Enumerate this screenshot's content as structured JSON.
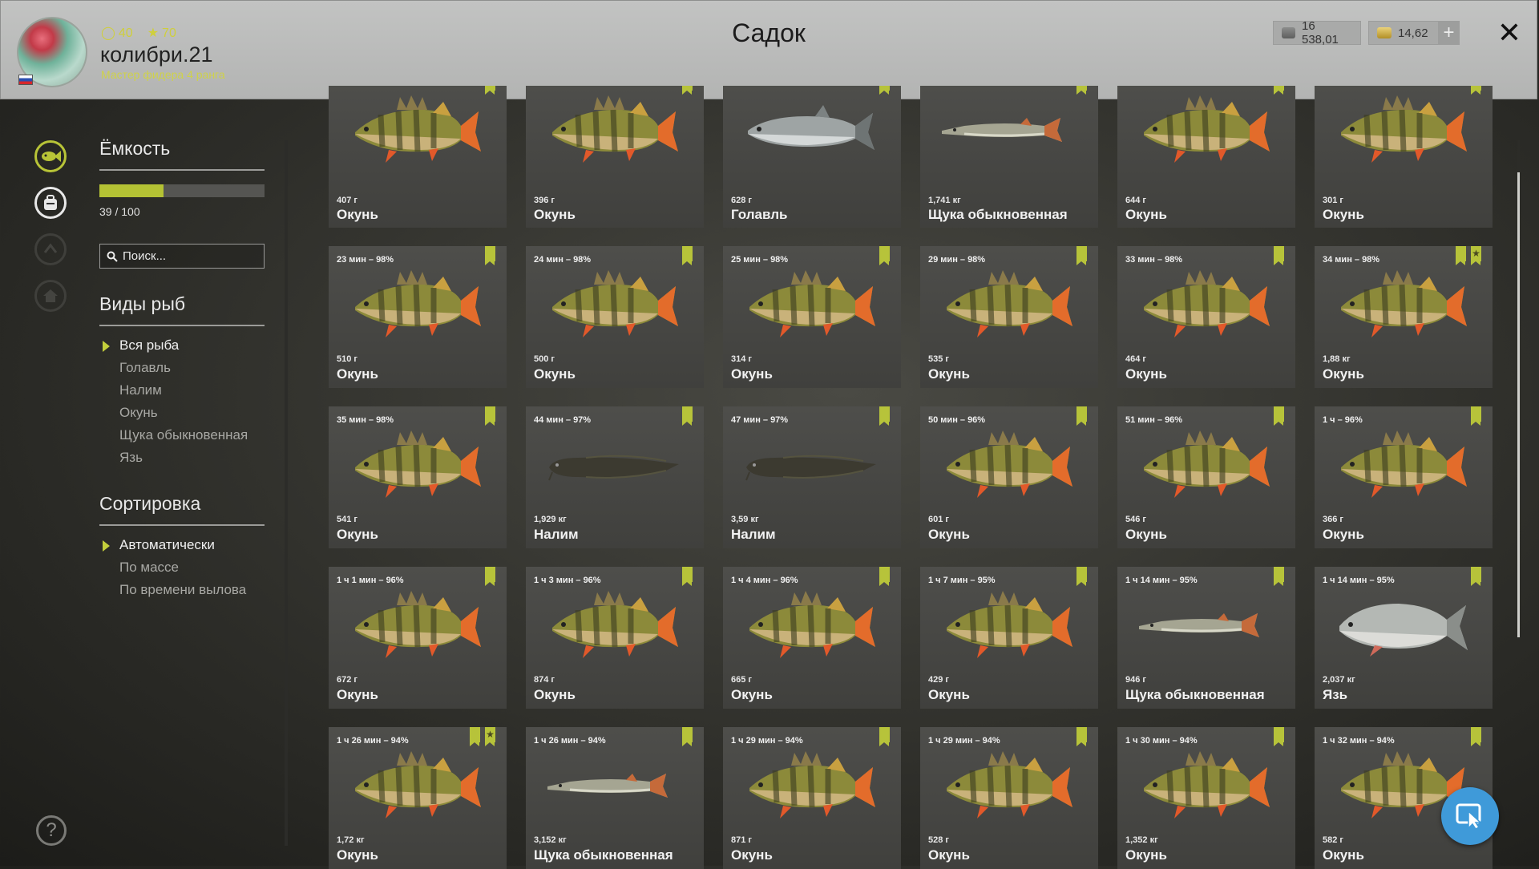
{
  "header": {
    "title": "Садок",
    "username": "колибри.21",
    "rank": "Мастер фидера 4 ранга",
    "stat_level": "40",
    "stat_stars": "70",
    "currency_silver": "16 538,01",
    "currency_gold": "14,62",
    "close_label": "✕",
    "plus_label": "+"
  },
  "panel": {
    "capacity_heading": "Ёмкость",
    "capacity_text": "39 / 100",
    "capacity_fraction": 0.39,
    "search_placeholder": "Поиск...",
    "species_heading": "Виды рыб",
    "species": [
      "Вся рыба",
      "Голавль",
      "Налим",
      "Окунь",
      "Щука обыкновенная",
      "Язь"
    ],
    "sort_heading": "Сортировка",
    "sort": [
      "Автоматически",
      "По массе",
      "По времени вылова"
    ]
  },
  "help_label": "?",
  "colors": {
    "accent": "#b7c33a",
    "fab": "#3f9ad9"
  },
  "cards": [
    {
      "time": "",
      "weight": "407 г",
      "name": "Окунь",
      "fish": "perch",
      "flags": 1
    },
    {
      "time": "",
      "weight": "396 г",
      "name": "Окунь",
      "fish": "perch",
      "flags": 1
    },
    {
      "time": "",
      "weight": "628 г",
      "name": "Голавль",
      "fish": "chub",
      "flags": 1
    },
    {
      "time": "",
      "weight": "1,741 кг",
      "name": "Щука обыкновенная",
      "fish": "pike",
      "flags": 1
    },
    {
      "time": "",
      "weight": "644 г",
      "name": "Окунь",
      "fish": "perch",
      "flags": 1
    },
    {
      "time": "",
      "weight": "301 г",
      "name": "Окунь",
      "fish": "perch",
      "flags": 1
    },
    {
      "time": "23 мин – 98%",
      "weight": "510 г",
      "name": "Окунь",
      "fish": "perch",
      "flags": 1
    },
    {
      "time": "24 мин – 98%",
      "weight": "500 г",
      "name": "Окунь",
      "fish": "perch",
      "flags": 1
    },
    {
      "time": "25 мин – 98%",
      "weight": "314 г",
      "name": "Окунь",
      "fish": "perch",
      "flags": 1
    },
    {
      "time": "29 мин – 98%",
      "weight": "535 г",
      "name": "Окунь",
      "fish": "perch",
      "flags": 1
    },
    {
      "time": "33 мин – 98%",
      "weight": "464 г",
      "name": "Окунь",
      "fish": "perch",
      "flags": 1
    },
    {
      "time": "34 мин – 98%",
      "weight": "1,88 кг",
      "name": "Окунь",
      "fish": "perch",
      "flags": 2
    },
    {
      "time": "35 мин – 98%",
      "weight": "541 г",
      "name": "Окунь",
      "fish": "perch",
      "flags": 1
    },
    {
      "time": "44 мин – 97%",
      "weight": "1,929 кг",
      "name": "Налим",
      "fish": "burbot",
      "flags": 1
    },
    {
      "time": "47 мин – 97%",
      "weight": "3,59 кг",
      "name": "Налим",
      "fish": "burbot",
      "flags": 1
    },
    {
      "time": "50 мин – 96%",
      "weight": "601 г",
      "name": "Окунь",
      "fish": "perch",
      "flags": 1
    },
    {
      "time": "51 мин – 96%",
      "weight": "546 г",
      "name": "Окунь",
      "fish": "perch",
      "flags": 1
    },
    {
      "time": "1 ч – 96%",
      "weight": "366 г",
      "name": "Окунь",
      "fish": "perch",
      "flags": 1
    },
    {
      "time": "1 ч 1 мин – 96%",
      "weight": "672 г",
      "name": "Окунь",
      "fish": "perch",
      "flags": 1
    },
    {
      "time": "1 ч 3 мин – 96%",
      "weight": "874 г",
      "name": "Окунь",
      "fish": "perch",
      "flags": 1
    },
    {
      "time": "1 ч 4 мин – 96%",
      "weight": "665 г",
      "name": "Окунь",
      "fish": "perch",
      "flags": 1
    },
    {
      "time": "1 ч 7 мин – 95%",
      "weight": "429 г",
      "name": "Окунь",
      "fish": "perch",
      "flags": 1
    },
    {
      "time": "1 ч 14 мин – 95%",
      "weight": "946 г",
      "name": "Щука обыкновенная",
      "fish": "pike",
      "flags": 1
    },
    {
      "time": "1 ч 14 мин – 95%",
      "weight": "2,037 кг",
      "name": "Язь",
      "fish": "ide",
      "flags": 1
    },
    {
      "time": "1 ч 26 мин – 94%",
      "weight": "1,72 кг",
      "name": "Окунь",
      "fish": "perch",
      "flags": 2
    },
    {
      "time": "1 ч 26 мин – 94%",
      "weight": "3,152 кг",
      "name": "Щука обыкновенная",
      "fish": "pike",
      "flags": 1
    },
    {
      "time": "1 ч 29 мин – 94%",
      "weight": "871 г",
      "name": "Окунь",
      "fish": "perch",
      "flags": 1
    },
    {
      "time": "1 ч 29 мин – 94%",
      "weight": "528 г",
      "name": "Окунь",
      "fish": "perch",
      "flags": 1
    },
    {
      "time": "1 ч 30 мин – 94%",
      "weight": "1,352 кг",
      "name": "Окунь",
      "fish": "perch",
      "flags": 1
    },
    {
      "time": "1 ч 32 мин – 94%",
      "weight": "582 г",
      "name": "Окунь",
      "fish": "perch",
      "flags": 1
    }
  ]
}
